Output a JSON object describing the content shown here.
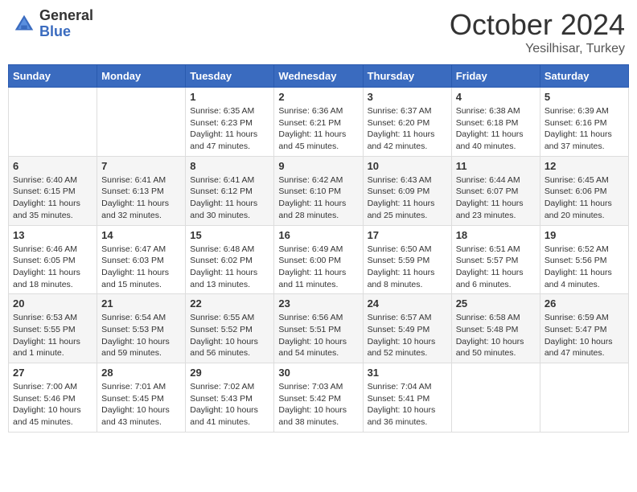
{
  "header": {
    "logo": {
      "general": "General",
      "blue": "Blue"
    },
    "month": "October 2024",
    "location": "Yesilhisar, Turkey"
  },
  "days_of_week": [
    "Sunday",
    "Monday",
    "Tuesday",
    "Wednesday",
    "Thursday",
    "Friday",
    "Saturday"
  ],
  "weeks": [
    [
      null,
      null,
      {
        "day": 1,
        "sunrise": "6:35 AM",
        "sunset": "6:23 PM",
        "daylight": "11 hours and 47 minutes."
      },
      {
        "day": 2,
        "sunrise": "6:36 AM",
        "sunset": "6:21 PM",
        "daylight": "11 hours and 45 minutes."
      },
      {
        "day": 3,
        "sunrise": "6:37 AM",
        "sunset": "6:20 PM",
        "daylight": "11 hours and 42 minutes."
      },
      {
        "day": 4,
        "sunrise": "6:38 AM",
        "sunset": "6:18 PM",
        "daylight": "11 hours and 40 minutes."
      },
      {
        "day": 5,
        "sunrise": "6:39 AM",
        "sunset": "6:16 PM",
        "daylight": "11 hours and 37 minutes."
      }
    ],
    [
      {
        "day": 6,
        "sunrise": "6:40 AM",
        "sunset": "6:15 PM",
        "daylight": "11 hours and 35 minutes."
      },
      {
        "day": 7,
        "sunrise": "6:41 AM",
        "sunset": "6:13 PM",
        "daylight": "11 hours and 32 minutes."
      },
      {
        "day": 8,
        "sunrise": "6:41 AM",
        "sunset": "6:12 PM",
        "daylight": "11 hours and 30 minutes."
      },
      {
        "day": 9,
        "sunrise": "6:42 AM",
        "sunset": "6:10 PM",
        "daylight": "11 hours and 28 minutes."
      },
      {
        "day": 10,
        "sunrise": "6:43 AM",
        "sunset": "6:09 PM",
        "daylight": "11 hours and 25 minutes."
      },
      {
        "day": 11,
        "sunrise": "6:44 AM",
        "sunset": "6:07 PM",
        "daylight": "11 hours and 23 minutes."
      },
      {
        "day": 12,
        "sunrise": "6:45 AM",
        "sunset": "6:06 PM",
        "daylight": "11 hours and 20 minutes."
      }
    ],
    [
      {
        "day": 13,
        "sunrise": "6:46 AM",
        "sunset": "6:05 PM",
        "daylight": "11 hours and 18 minutes."
      },
      {
        "day": 14,
        "sunrise": "6:47 AM",
        "sunset": "6:03 PM",
        "daylight": "11 hours and 15 minutes."
      },
      {
        "day": 15,
        "sunrise": "6:48 AM",
        "sunset": "6:02 PM",
        "daylight": "11 hours and 13 minutes."
      },
      {
        "day": 16,
        "sunrise": "6:49 AM",
        "sunset": "6:00 PM",
        "daylight": "11 hours and 11 minutes."
      },
      {
        "day": 17,
        "sunrise": "6:50 AM",
        "sunset": "5:59 PM",
        "daylight": "11 hours and 8 minutes."
      },
      {
        "day": 18,
        "sunrise": "6:51 AM",
        "sunset": "5:57 PM",
        "daylight": "11 hours and 6 minutes."
      },
      {
        "day": 19,
        "sunrise": "6:52 AM",
        "sunset": "5:56 PM",
        "daylight": "11 hours and 4 minutes."
      }
    ],
    [
      {
        "day": 20,
        "sunrise": "6:53 AM",
        "sunset": "5:55 PM",
        "daylight": "11 hours and 1 minute."
      },
      {
        "day": 21,
        "sunrise": "6:54 AM",
        "sunset": "5:53 PM",
        "daylight": "10 hours and 59 minutes."
      },
      {
        "day": 22,
        "sunrise": "6:55 AM",
        "sunset": "5:52 PM",
        "daylight": "10 hours and 56 minutes."
      },
      {
        "day": 23,
        "sunrise": "6:56 AM",
        "sunset": "5:51 PM",
        "daylight": "10 hours and 54 minutes."
      },
      {
        "day": 24,
        "sunrise": "6:57 AM",
        "sunset": "5:49 PM",
        "daylight": "10 hours and 52 minutes."
      },
      {
        "day": 25,
        "sunrise": "6:58 AM",
        "sunset": "5:48 PM",
        "daylight": "10 hours and 50 minutes."
      },
      {
        "day": 26,
        "sunrise": "6:59 AM",
        "sunset": "5:47 PM",
        "daylight": "10 hours and 47 minutes."
      }
    ],
    [
      {
        "day": 27,
        "sunrise": "7:00 AM",
        "sunset": "5:46 PM",
        "daylight": "10 hours and 45 minutes."
      },
      {
        "day": 28,
        "sunrise": "7:01 AM",
        "sunset": "5:45 PM",
        "daylight": "10 hours and 43 minutes."
      },
      {
        "day": 29,
        "sunrise": "7:02 AM",
        "sunset": "5:43 PM",
        "daylight": "10 hours and 41 minutes."
      },
      {
        "day": 30,
        "sunrise": "7:03 AM",
        "sunset": "5:42 PM",
        "daylight": "10 hours and 38 minutes."
      },
      {
        "day": 31,
        "sunrise": "7:04 AM",
        "sunset": "5:41 PM",
        "daylight": "10 hours and 36 minutes."
      },
      null,
      null
    ]
  ],
  "labels": {
    "sunrise": "Sunrise:",
    "sunset": "Sunset:",
    "daylight": "Daylight:"
  }
}
